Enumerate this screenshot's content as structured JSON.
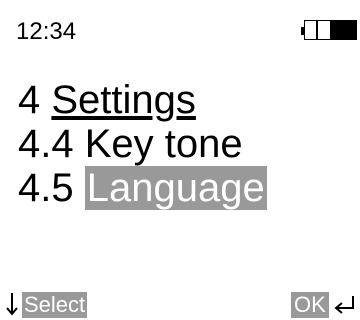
{
  "status_bar": {
    "time": "12:34",
    "battery_level": 0.5,
    "battery_icon": "battery-icon"
  },
  "menu": {
    "title_number": "4",
    "title_label": "Settings",
    "items": [
      {
        "number": "4.4",
        "label": "Key tone",
        "selected": false
      },
      {
        "number": "4.5",
        "label": "Language",
        "selected": true
      }
    ]
  },
  "softkeys": {
    "left_icon": "down-arrow-icon",
    "left_label": "Select",
    "right_label": "OK",
    "right_icon": "enter-icon"
  },
  "colors": {
    "highlight": "#999999",
    "text": "#000000",
    "background": "#ffffff"
  }
}
